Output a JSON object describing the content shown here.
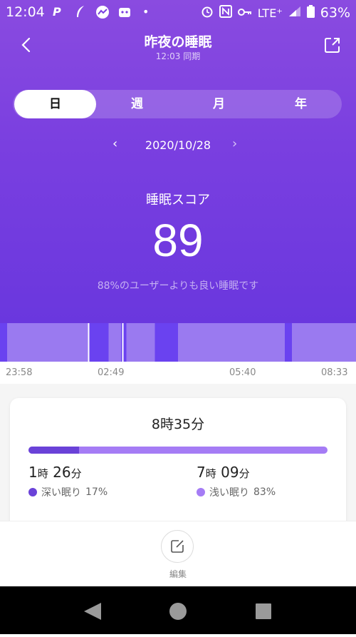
{
  "status_bar": {
    "time": "12:04",
    "left_icons": [
      "P",
      "feather-icon",
      "chart-icon",
      "bot-icon",
      "•"
    ],
    "right_icons": [
      "alarm-icon",
      "nfc-icon",
      "key-icon"
    ],
    "network": "LTE⁺",
    "battery": "63%"
  },
  "header": {
    "title": "昨夜の睡眠",
    "subtitle": "12:03 同期"
  },
  "tabs": [
    {
      "label": "日",
      "active": true
    },
    {
      "label": "週",
      "active": false
    },
    {
      "label": "月",
      "active": false
    },
    {
      "label": "年",
      "active": false
    }
  ],
  "date_nav": {
    "prev": "‹",
    "date": "2020/10/28",
    "next": "›"
  },
  "score": {
    "label": "睡眠スコア",
    "value": "89",
    "description": "88%のユーザーよりも良い睡眠です"
  },
  "sleep_chart": {
    "start": "23:58",
    "end": "08:33",
    "segments": [
      {
        "start": 0.0,
        "end": 0.02,
        "stage": "deep"
      },
      {
        "start": 0.02,
        "end": 0.25,
        "stage": "light"
      },
      {
        "start": 0.25,
        "end": 0.305,
        "stage": "deep"
      },
      {
        "start": 0.305,
        "end": 0.34,
        "stage": "light"
      },
      {
        "start": 0.34,
        "end": 0.355,
        "stage": "deep"
      },
      {
        "start": 0.355,
        "end": 0.435,
        "stage": "light"
      },
      {
        "start": 0.435,
        "end": 0.5,
        "stage": "deep"
      },
      {
        "start": 0.5,
        "end": 0.8,
        "stage": "light"
      },
      {
        "start": 0.8,
        "end": 0.82,
        "stage": "deep"
      },
      {
        "start": 0.82,
        "end": 1.0,
        "stage": "light"
      }
    ],
    "tick_labels": [
      "23:58",
      "02:49",
      "05:40",
      "08:33"
    ],
    "colors": {
      "deep": "#6a42f0",
      "light": "#9a7af0"
    }
  },
  "summary": {
    "total": "8時35分",
    "deep": {
      "hours": "1",
      "h_unit": "時",
      "minutes": "26",
      "m_unit": "分",
      "label": "深い眠り",
      "percent": "17%",
      "fraction": 0.17,
      "color": "#6a42d8"
    },
    "light": {
      "hours": "7",
      "h_unit": "時",
      "minutes": "09",
      "m_unit": "分",
      "label": "浅い眠り",
      "percent": "83%",
      "fraction": 0.83,
      "color": "#a57cf5"
    }
  },
  "edit": {
    "label": "編集"
  },
  "navbar": {
    "buttons": [
      "back-icon",
      "home-icon",
      "recents-icon"
    ]
  }
}
